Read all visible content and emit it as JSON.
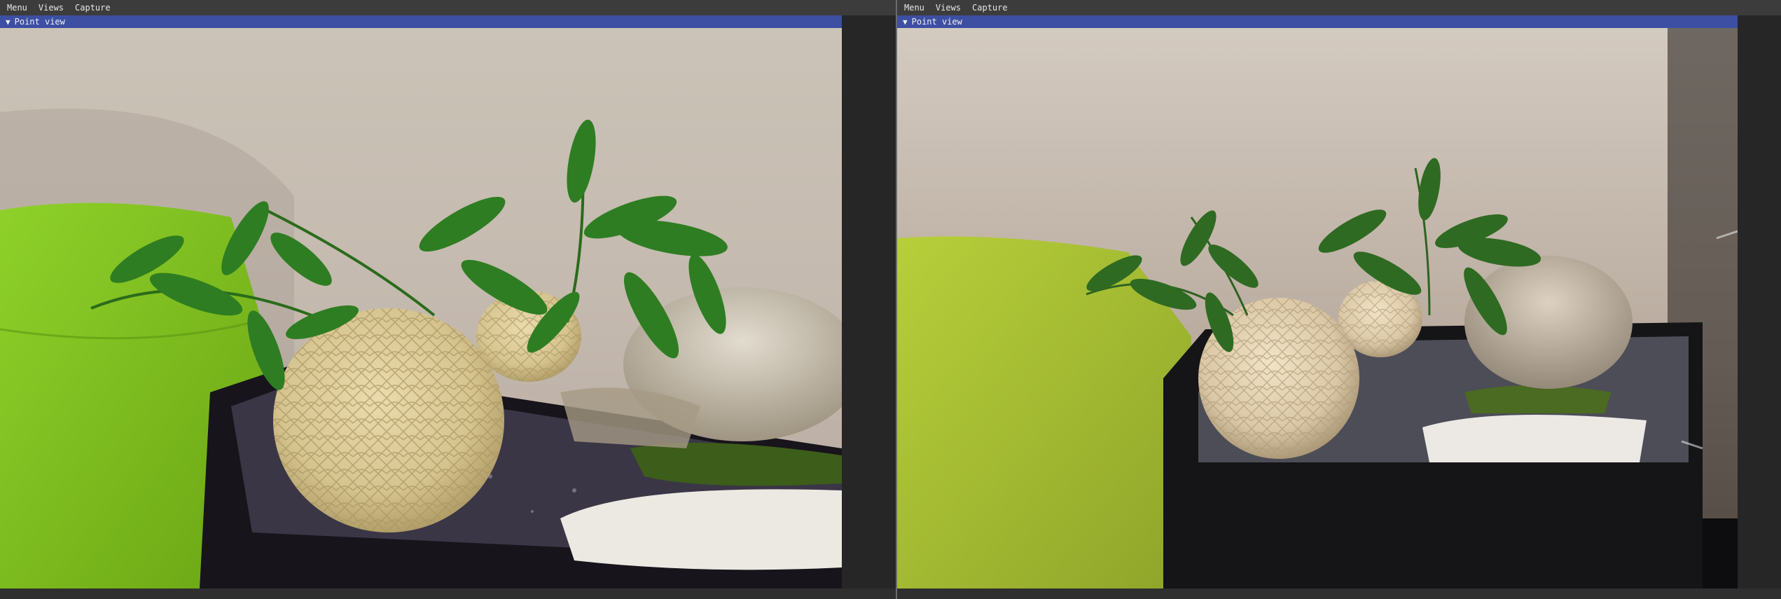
{
  "left_app": {
    "menu": [
      "Menu",
      "Views",
      "Capture"
    ],
    "window_title": "Point view",
    "arrow": "▼"
  },
  "right_app": {
    "menu": [
      "Menu",
      "Views",
      "Capture"
    ],
    "window_title": "Point view",
    "arrow": "▼"
  },
  "colors": {
    "titlebar": "#3d4fa3",
    "menubar": "#3c3c3c",
    "wall": "#c9bfb2",
    "stool_green": "#7fc11c",
    "fern_green": "#2f7d22",
    "ball": "#d8c79a"
  }
}
